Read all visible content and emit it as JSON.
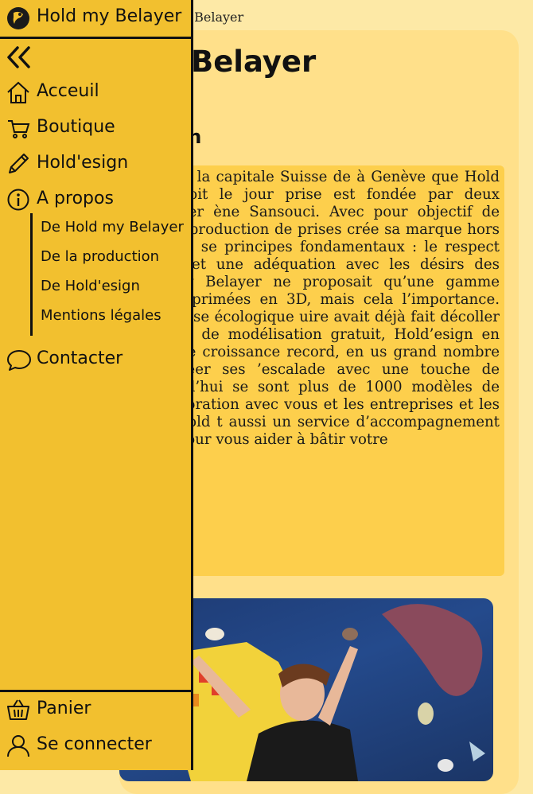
{
  "page": {
    "breadcrumb": "y Belayer",
    "title": "Belayer",
    "section_title": "tion",
    "paragraph": "des Alpes dans la capitale Suisse de à Genève que Hold my Belayer voit le jour prise est fondée par deux Français : Olier ène Sansouci. Avec pour objectif de domaine de la production de prises crée sa marque hors du commun en se principes fondamentaux : le respect de la qualité et une adéquation avec les désirs des grimpeurs. my Belayer ne proposait qu’une gamme d’escalades imprimées en 3D, mais cela l’importance. L’idée d’une prise écologique uire avait déjà fait décoller l’entreprise. til de modélisation gratuit, Hold’esign en enregistrer une croissance record, en us grand nombre la joie de créer ses ’escalade avec une touche de conscience urd’hui se sont plus de 1000 modèles de pées en collaboration avec vous et les entreprises et les particuliers. Hold t aussi un service d’accompagnement et erformant pour vous aider à bâtir votre"
  },
  "sidebar": {
    "brand": "Hold my Belayer",
    "items": [
      {
        "label": "Acceuil",
        "icon": "home-icon"
      },
      {
        "label": "Boutique",
        "icon": "cart-icon"
      },
      {
        "label": "Hold'esign",
        "icon": "pencil-icon"
      },
      {
        "label": "A propos",
        "icon": "info-icon"
      }
    ],
    "submenu": [
      {
        "label": "De Hold my Belayer"
      },
      {
        "label": "De la production"
      },
      {
        "label": "De Hold'esign"
      },
      {
        "label": "Mentions légales"
      }
    ],
    "contact": {
      "label": "Contacter",
      "icon": "chat-icon"
    },
    "bottom": [
      {
        "label": "Panier",
        "icon": "basket-icon"
      },
      {
        "label": "Se connecter",
        "icon": "user-icon"
      }
    ]
  },
  "colors": {
    "sidebar_bg": "#f2c02f",
    "page_bg": "#fde9a6",
    "card_bg": "#ffe08a",
    "text_box_bg": "#fdcf4c"
  }
}
